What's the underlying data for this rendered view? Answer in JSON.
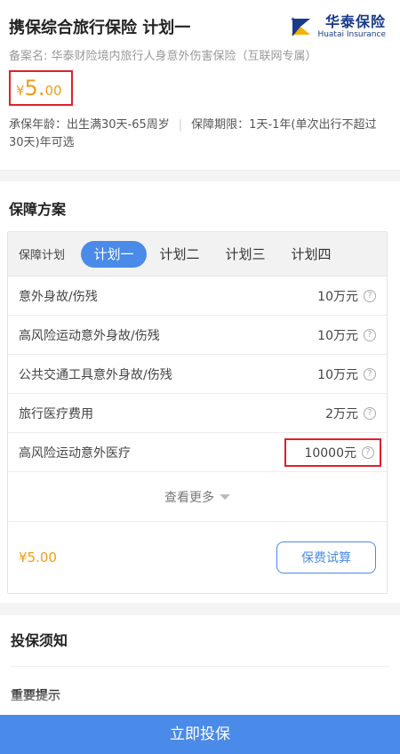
{
  "header": {
    "title": "携保综合旅行保险 计划一",
    "logo_cn": "华泰保险",
    "logo_en": "Huatai Insurance",
    "record": "备案名: 华泰财险境内旅行人身意外伤害保险（互联网专属）",
    "price_symbol": "¥",
    "price_int": "5.",
    "price_dec": "00",
    "age": "承保年龄：出生满30天-65周岁",
    "period": "保障期限：1天-1年(单次出行不超过30天)年可选"
  },
  "plan": {
    "heading": "保障方案",
    "tab_label": "保障计划",
    "tabs": [
      "计划一",
      "计划二",
      "计划三",
      "计划四"
    ],
    "rows": [
      {
        "name": "意外身故/伤残",
        "amount": "10万元"
      },
      {
        "name": "高风险运动意外身故/伤残",
        "amount": "10万元"
      },
      {
        "name": "公共交通工具意外身故/伤残",
        "amount": "10万元"
      },
      {
        "name": "旅行医疗费用",
        "amount": "2万元"
      },
      {
        "name": "高风险运动意外医疗",
        "amount": "10000元"
      }
    ],
    "help_glyph": "?",
    "more": "查看更多",
    "calc_price_symbol": "¥",
    "calc_price_int": "5.",
    "calc_price_dec": "00",
    "calc_button": "保费试算"
  },
  "notice": {
    "title": "投保须知",
    "sub": "重要提示",
    "faded": "······"
  },
  "footer": {
    "buy": "立即投保"
  },
  "colors": {
    "accent": "#4a8ae8",
    "price": "#f29b1d",
    "highlight": "#e0202a"
  }
}
